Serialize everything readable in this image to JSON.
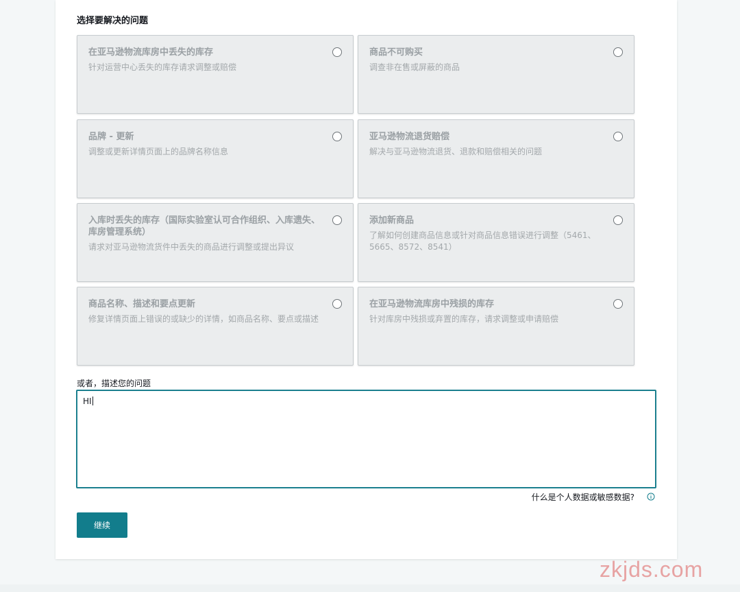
{
  "section_title": "选择要解决的问题",
  "cards": [
    {
      "title": "在亚马逊物流库房中丢失的库存",
      "desc": "针对运营中心丢失的库存请求调整或赔偿"
    },
    {
      "title": "商品不可购买",
      "desc": "调查非在售或屏蔽的商品"
    },
    {
      "title": "品牌 - 更新",
      "desc": "调整或更新详情页面上的品牌名称信息"
    },
    {
      "title": "亚马逊物流退货赔偿",
      "desc": "解决与亚马逊物流退货、退款和赔偿相关的问题"
    },
    {
      "title": "入库时丢失的库存（国际实验室认可合作组织、入库遗失、库房管理系统）",
      "desc": "请求对亚马逊物流货件中丢失的商品进行调整或提出异议"
    },
    {
      "title": "添加新商品",
      "desc": "了解如何创建商品信息或针对商品信息错误进行调整（5461、5665、8572、8541）"
    },
    {
      "title": "商品名称、描述和要点更新",
      "desc": "修复详情页面上错误的或缺少的详情，如商品名称、要点或描述"
    },
    {
      "title": "在亚马逊物流库房中残损的库存",
      "desc": "针对库房中残损或弃置的库存，请求调整或申请赔偿"
    }
  ],
  "describe": {
    "label": "或者，描述您的问题",
    "value": "HI"
  },
  "help_link": "什么是个人数据或敏感数据?",
  "continue_label": "继续",
  "watermark": "zkjds.com",
  "colors": {
    "accent": "#127d8c",
    "card_bg": "#ebedee"
  }
}
